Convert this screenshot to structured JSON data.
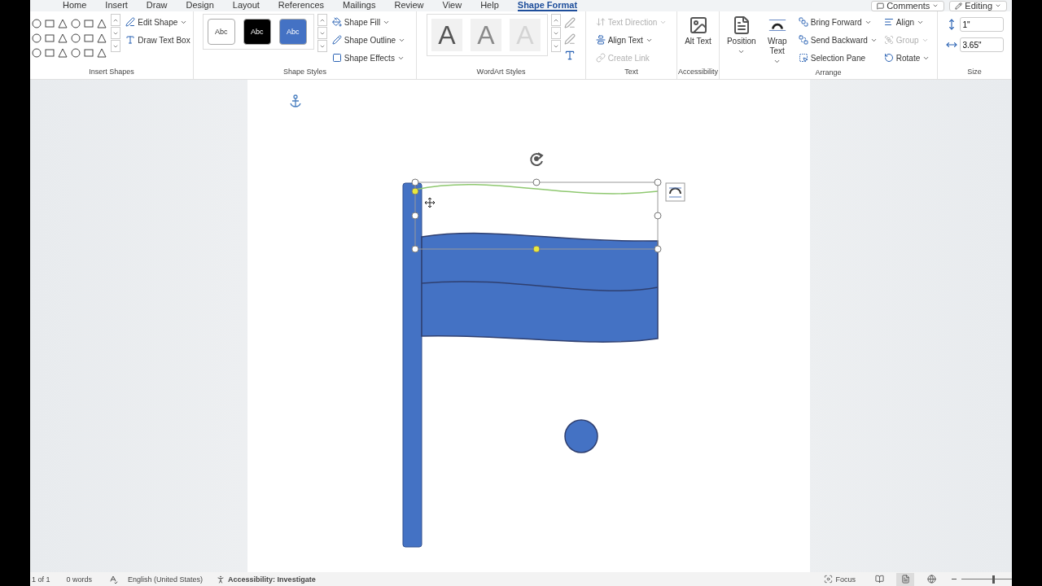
{
  "tabs": [
    {
      "label": "Home",
      "selected": false
    },
    {
      "label": "Insert",
      "selected": false
    },
    {
      "label": "Draw",
      "selected": false
    },
    {
      "label": "Design",
      "selected": false
    },
    {
      "label": "Layout",
      "selected": false
    },
    {
      "label": "References",
      "selected": false
    },
    {
      "label": "Mailings",
      "selected": false
    },
    {
      "label": "Review",
      "selected": false
    },
    {
      "label": "View",
      "selected": false
    },
    {
      "label": "Help",
      "selected": false
    },
    {
      "label": "Shape Format",
      "selected": true
    }
  ],
  "top_buttons": [
    {
      "label": "Comments"
    },
    {
      "label": "Editing"
    }
  ],
  "groups": [
    {
      "kind": "shapes",
      "label": "Insert Shapes",
      "commands": [
        {
          "label": "Edit Shape",
          "disabled": false,
          "dropdown": true
        },
        {
          "label": "Draw Text Box",
          "disabled": false,
          "dropdown": false
        }
      ]
    },
    {
      "kind": "styles",
      "label": "Shape Styles",
      "swatches": [
        {
          "label": "Abc",
          "color": "#ffffff"
        },
        {
          "label": "Abc",
          "color": "#000000"
        },
        {
          "label": "Abc",
          "color": "#4472c4"
        }
      ],
      "commands": [
        {
          "label": "Shape Fill",
          "disabled": false,
          "dropdown": true
        },
        {
          "label": "Shape Outline",
          "disabled": false,
          "dropdown": true
        },
        {
          "label": "Shape Effects",
          "disabled": false,
          "dropdown": true
        }
      ]
    },
    {
      "kind": "wordart",
      "label": "WordArt Styles",
      "letters": [
        {
          "label": "A",
          "color": "#555555"
        },
        {
          "label": "A",
          "color": "#8a8a8a"
        },
        {
          "label": "A",
          "color": "#d4d4d4"
        }
      ]
    },
    {
      "kind": "commands",
      "label": "Text",
      "commands": [
        {
          "label": "Text Direction",
          "disabled": true,
          "dropdown": true
        },
        {
          "label": "Align Text",
          "disabled": false,
          "dropdown": true
        },
        {
          "label": "Create Link",
          "disabled": true,
          "dropdown": false
        }
      ]
    },
    {
      "kind": "large",
      "label": "Accessibility",
      "buttons": [
        {
          "label": "Alt Text"
        }
      ]
    },
    {
      "kind": "arrange",
      "label": "Arrange",
      "buttons": [
        {
          "label": "Position",
          "dropdown": true
        },
        {
          "label": "Wrap Text",
          "dropdown": true
        }
      ],
      "commands": [
        {
          "label": "Bring Forward",
          "disabled": false,
          "dropdown": true
        },
        {
          "label": "Send Backward",
          "disabled": false,
          "dropdown": true
        },
        {
          "label": "Selection Pane",
          "disabled": false,
          "dropdown": false
        },
        {
          "label": "Align",
          "disabled": false,
          "dropdown": true
        },
        {
          "label": "Group",
          "disabled": true,
          "dropdown": true
        },
        {
          "label": "Rotate",
          "disabled": false,
          "dropdown": true
        }
      ]
    },
    {
      "kind": "size",
      "label": "Size",
      "fields": [
        {
          "value": "1\""
        },
        {
          "value": "3.65\""
        }
      ]
    }
  ],
  "status_bar": {
    "page": "1 of 1",
    "words": "0 words",
    "language": "English (United States)",
    "accessibility": "Accessibility: Investigate",
    "focus": "Focus",
    "views": [
      {
        "selected": false
      },
      {
        "selected": true
      },
      {
        "selected": false
      }
    ],
    "zoom": {
      "level": 0.65
    }
  }
}
